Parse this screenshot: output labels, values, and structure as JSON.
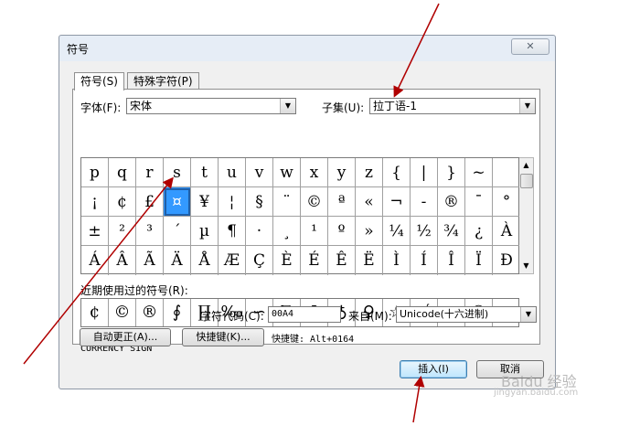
{
  "dialog": {
    "title": "符号",
    "close_label": "✕"
  },
  "tabs": [
    {
      "label": "符号(S)"
    },
    {
      "label": "特殊字符(P)"
    }
  ],
  "font": {
    "label": "字体(F):",
    "value": "宋体"
  },
  "subset": {
    "label": "子集(U):",
    "value": "拉丁语-1"
  },
  "symbols": [
    [
      "p",
      "q",
      "r",
      "s",
      "t",
      "u",
      "v",
      "w",
      "x",
      "y",
      "z",
      "{",
      "|",
      "}",
      "~",
      ""
    ],
    [
      "¡",
      "¢",
      "£",
      "¤",
      "¥",
      "¦",
      "§",
      "¨",
      "©",
      "ª",
      "«",
      "¬",
      "-",
      "®",
      "¯",
      "°"
    ],
    [
      "±",
      "²",
      "³",
      "´",
      "µ",
      "¶",
      "·",
      "¸",
      "¹",
      "º",
      "»",
      "¼",
      "½",
      "¾",
      "¿",
      "À"
    ],
    [
      "Á",
      "Â",
      "Ã",
      "Ä",
      "Å",
      "Æ",
      "Ç",
      "È",
      "É",
      "Ê",
      "Ë",
      "Ì",
      "Í",
      "Î",
      "Ï",
      "Ð"
    ]
  ],
  "selected_symbol": "¤",
  "recent": {
    "label": "近期使用过的符号(R):",
    "symbols": [
      "¢",
      "©",
      "®",
      "∮",
      "∏",
      "‰",
      "∽",
      "∑",
      "Ⅰ",
      "♁",
      "♀",
      "☆",
      "√",
      "≈",
      "①",
      "→"
    ]
  },
  "char_name": "CURRENCY SIGN",
  "char_code": {
    "label": "字符代码(C):",
    "value": "00A4"
  },
  "from": {
    "label": "来自(M):",
    "value": "Unicode(十六进制)"
  },
  "buttons": {
    "autocorrect": "自动更正(A)...",
    "shortcut_key": "快捷键(K)...",
    "shortcut_text": "快捷键: Alt+0164",
    "insert": "插入(I)",
    "cancel": "取消"
  },
  "watermark": {
    "text": "Baidu 经验",
    "url": "jingyan.baidu.com"
  },
  "colors": {
    "selection": "#3399ff",
    "annotation_arrow": "#b00000"
  }
}
